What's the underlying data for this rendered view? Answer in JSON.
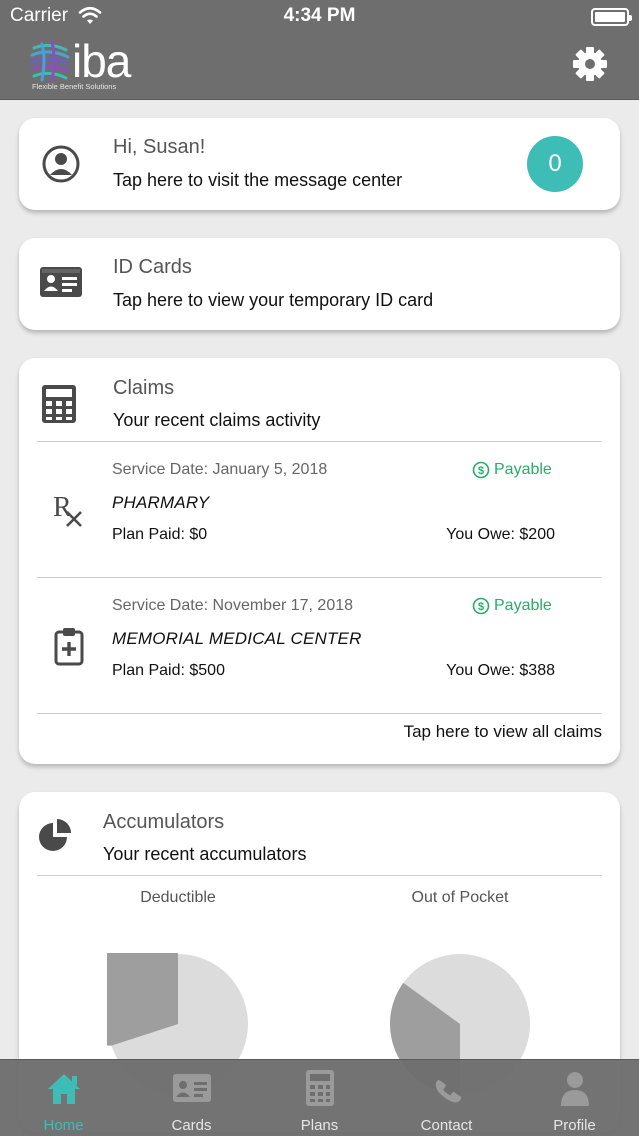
{
  "status_bar": {
    "carrier": "Carrier",
    "time": "4:34 PM"
  },
  "header": {
    "logo_text": "iba",
    "logo_tagline": "Flexible Benefit Solutions",
    "settings_icon": "gear-icon"
  },
  "greeting_card": {
    "title": "Hi, Susan!",
    "subtitle": "Tap here to visit the message center",
    "message_count": "0"
  },
  "id_card": {
    "title": "ID Cards",
    "subtitle": "Tap here to view your temporary ID card"
  },
  "claims": {
    "title": "Claims",
    "subtitle": "Your recent claims activity",
    "items": [
      {
        "date": "Service Date: January 5, 2018",
        "status": "Payable",
        "provider": "PHARMARY",
        "plan_paid": "Plan Paid: $0",
        "you_owe": "You Owe: $200",
        "icon": "rx-icon"
      },
      {
        "date": "Service Date: November 17, 2018",
        "status": "Payable",
        "provider": "MEMORIAL MEDICAL CENTER",
        "plan_paid": "Plan Paid: $500",
        "you_owe": "You Owe: $388",
        "icon": "medical-clipboard-icon"
      }
    ],
    "view_all": "Tap here to view all claims"
  },
  "accumulators": {
    "title": "Accumulators",
    "subtitle": "Your recent accumulators",
    "deductible_label": "Deductible",
    "oop_label": "Out of Pocket",
    "deductible_met_fraction": 0.7,
    "oop_met_fraction": 0.35
  },
  "tabs": [
    {
      "label": "Home",
      "icon": "home-icon",
      "active": true
    },
    {
      "label": "Cards",
      "icon": "id-card-icon",
      "active": false
    },
    {
      "label": "Plans",
      "icon": "calculator-icon",
      "active": false
    },
    {
      "label": "Contact",
      "icon": "phone-icon",
      "active": false
    },
    {
      "label": "Profile",
      "icon": "person-icon",
      "active": false
    }
  ],
  "colors": {
    "accent": "#3dbdb6",
    "payable": "#27ad6b",
    "header": "#6e6e6e"
  }
}
